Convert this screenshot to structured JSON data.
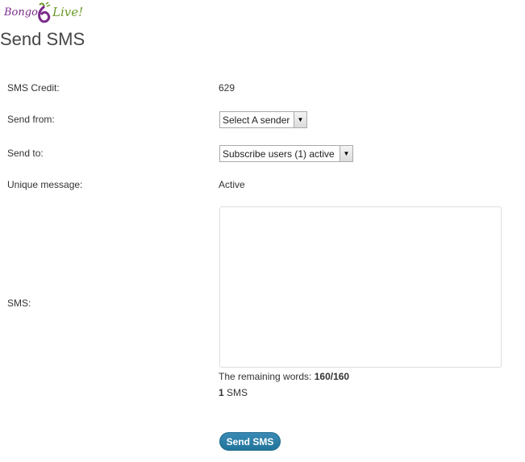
{
  "logo": {
    "word1": "Bongo",
    "word2": "Live!"
  },
  "page_title": "Send SMS",
  "form": {
    "credit": {
      "label": "SMS Credit:",
      "value": "629"
    },
    "send_from": {
      "label": "Send from:",
      "selected": "Select A sender"
    },
    "send_to": {
      "label": "Send to:",
      "selected": "Subscribe users (1) active"
    },
    "unique": {
      "label": "Unique message:",
      "value": "Active"
    },
    "sms": {
      "label": "SMS:",
      "value": ""
    },
    "remaining": {
      "prefix": "The remaining words: ",
      "count": "160/160"
    },
    "sms_count": {
      "number": "1",
      "suffix": " SMS"
    },
    "submit_label": "Send SMS"
  },
  "colors": {
    "button": "#21759b",
    "logo_purple": "#7b2a8a",
    "logo_green": "#6d9a2a"
  }
}
